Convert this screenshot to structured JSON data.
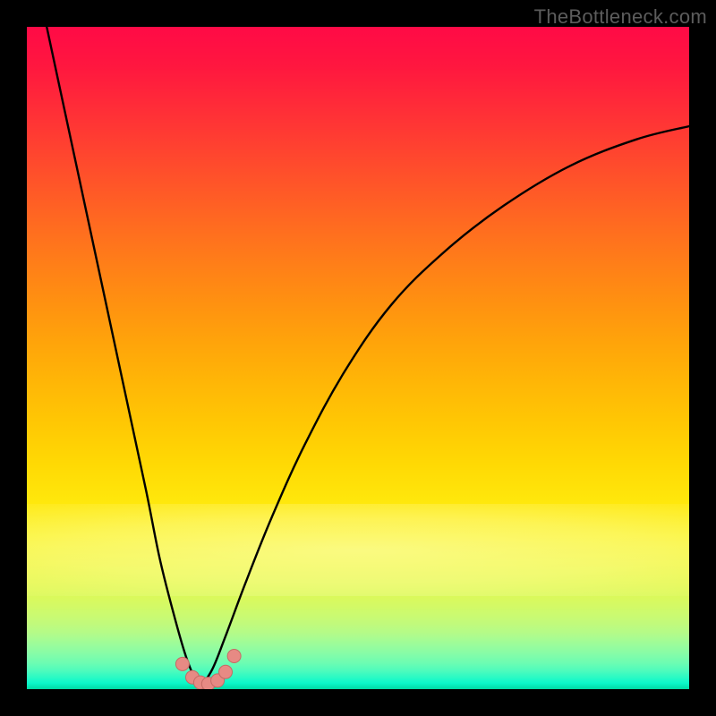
{
  "watermark": "TheBottleneck.com",
  "colors": {
    "background": "#000000",
    "curve_stroke": "#000000",
    "marker_fill": "#e78a84",
    "marker_stroke": "#c46a64"
  },
  "chart_data": {
    "type": "line",
    "title": "",
    "xlabel": "",
    "ylabel": "",
    "xlim": [
      0,
      100
    ],
    "ylim": [
      0,
      100
    ],
    "grid": false,
    "note": "Curves approach zero at x≈26 forming a U/V shape; values estimated visually as fraction of plot height (0 bottom, 100 top).",
    "series": [
      {
        "name": "left-branch",
        "x": [
          3,
          6,
          9,
          12,
          15,
          18,
          20,
          22,
          24,
          26
        ],
        "y": [
          100,
          86,
          72,
          58,
          44,
          30,
          20,
          12,
          5,
          0
        ]
      },
      {
        "name": "right-branch",
        "x": [
          26,
          28,
          30,
          33,
          37,
          42,
          48,
          55,
          63,
          72,
          82,
          92,
          100
        ],
        "y": [
          0,
          3,
          8,
          16,
          26,
          37,
          48,
          58,
          66,
          73,
          79,
          83,
          85
        ]
      }
    ],
    "markers": {
      "note": "Pink dot cluster at valley floor",
      "x": [
        23.5,
        25.0,
        26.2,
        27.4,
        28.8,
        30.0,
        31.3
      ],
      "y": [
        3.8,
        1.8,
        1.0,
        0.8,
        1.3,
        2.6,
        5.0
      ]
    }
  }
}
